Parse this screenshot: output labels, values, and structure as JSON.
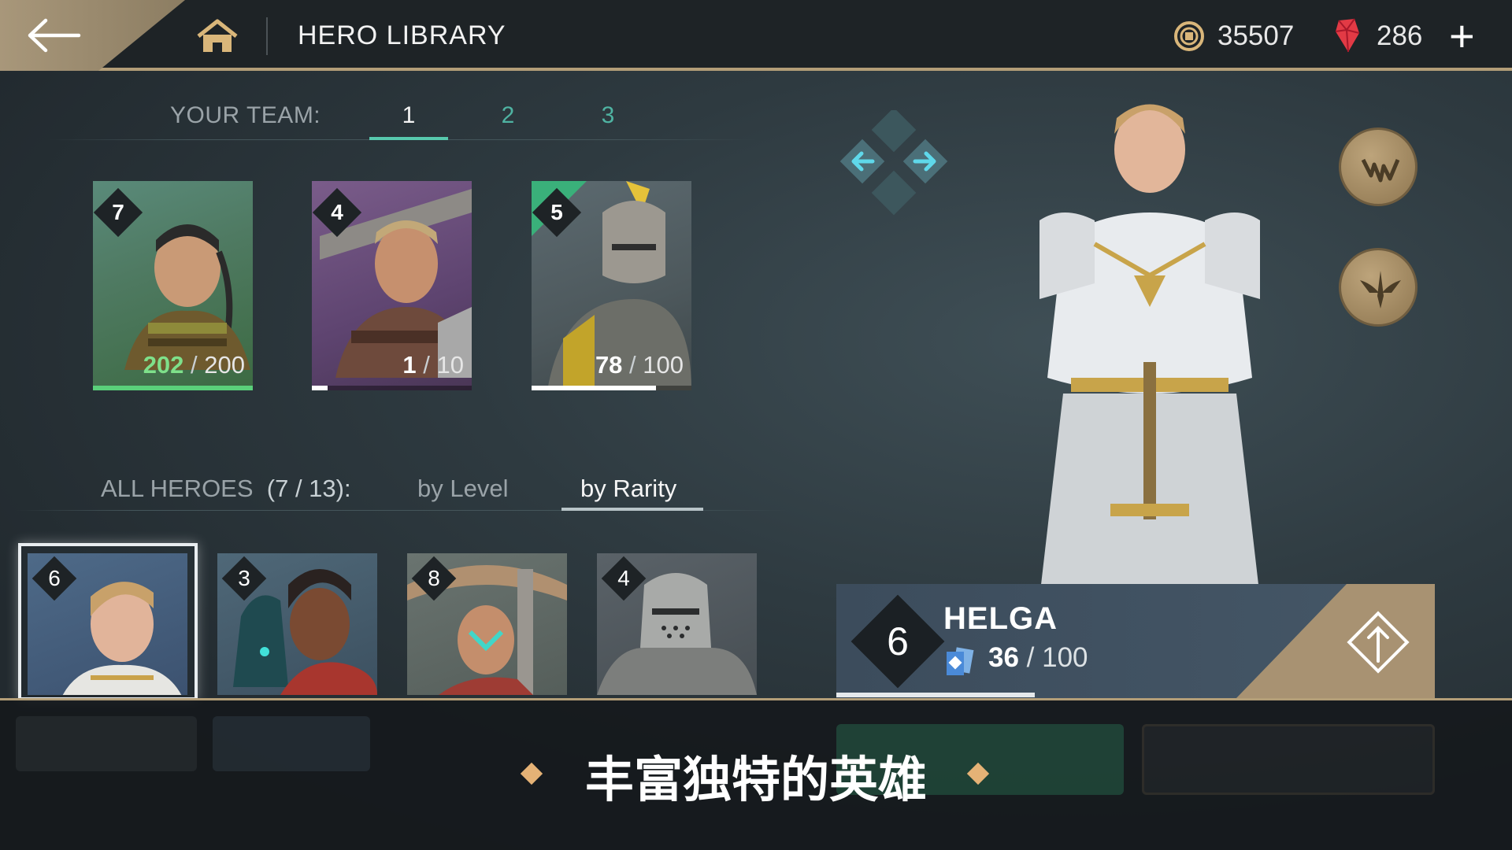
{
  "header": {
    "title": "HERO LIBRARY",
    "coins": "35507",
    "gems": "286",
    "add_label": "+"
  },
  "team": {
    "label": "YOUR TEAM:",
    "tabs": [
      "1",
      "2",
      "3"
    ],
    "active_tab": "1",
    "cards": [
      {
        "level": "7",
        "current": "202",
        "sep": " / ",
        "max": "200",
        "progress": 1.0,
        "bar_color": "#5ad07a",
        "theme": "green"
      },
      {
        "level": "4",
        "current": "1",
        "sep": " / ",
        "max": "10",
        "progress": 0.1,
        "bar_color": "#ffffff",
        "theme": "purple"
      },
      {
        "level": "5",
        "current": "78",
        "sep": " / ",
        "max": "100",
        "progress": 0.78,
        "bar_color": "#ffffff",
        "theme": "gray"
      }
    ]
  },
  "all_heroes": {
    "label": "ALL HEROES",
    "count": "(7 / 13):",
    "sort_level": "by Level",
    "sort_rarity": "by Rarity",
    "cards": [
      {
        "level": "6"
      },
      {
        "level": "3"
      },
      {
        "level": "8"
      },
      {
        "level": "4"
      }
    ]
  },
  "selected_hero": {
    "level": "6",
    "name": "HELGA",
    "current": "36",
    "sep": " / ",
    "max": "100",
    "progress": 0.36
  },
  "banner": {
    "caption": "丰富独特的英雄"
  },
  "colors": {
    "accent_gold": "#b39e78",
    "team_teal": "#57c9ad",
    "gem_red": "#e23a45"
  }
}
